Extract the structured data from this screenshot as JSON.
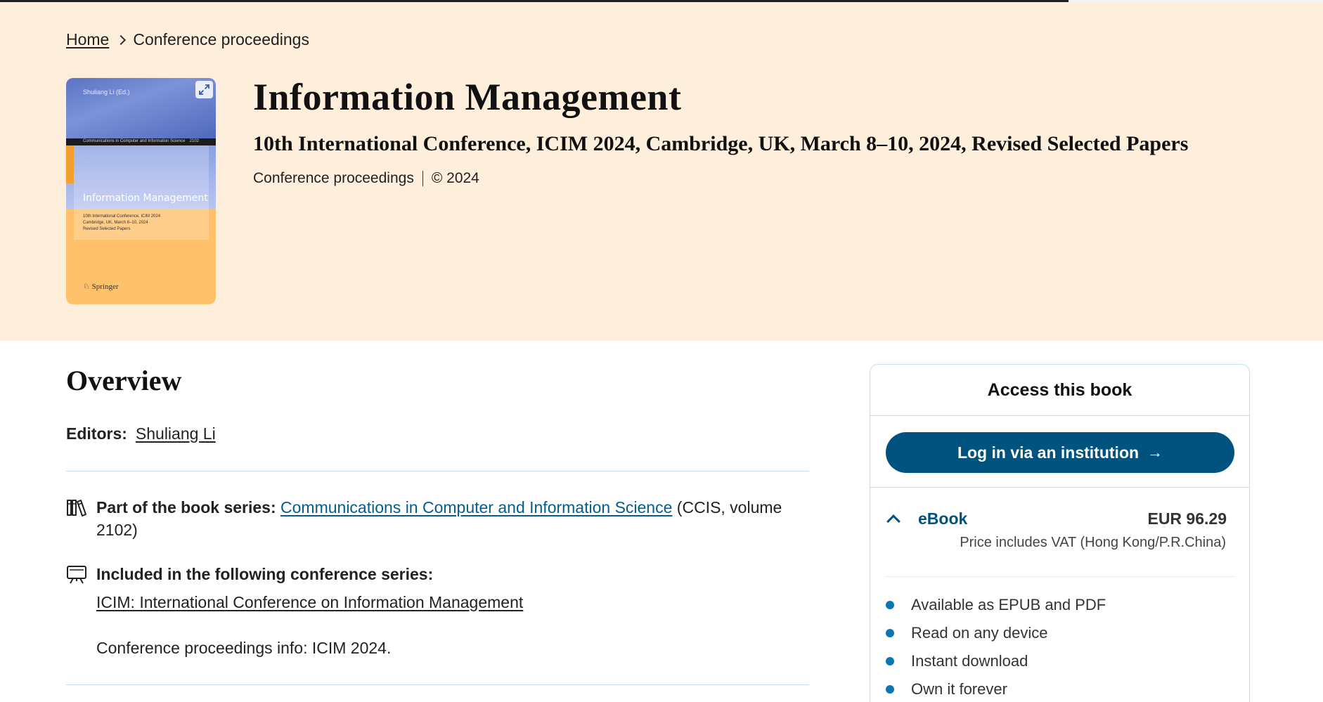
{
  "breadcrumb": {
    "home": "Home",
    "current": "Conference proceedings"
  },
  "cover": {
    "editor": "Shuliang Li (Ed.)",
    "series": "Communications in Computer and Information Science",
    "volume": "2102",
    "title": "Information Management",
    "subtitle_lines": [
      "10th International Conference, ICIM 2024",
      "Cambridge, UK, March 8–10, 2024",
      "Revised Selected Papers"
    ],
    "publisher": "Springer"
  },
  "book": {
    "title": "Information Management",
    "subtitle": "10th International Conference, ICIM 2024, Cambridge, UK, March 8–10, 2024, Revised Selected Papers",
    "type": "Conference proceedings",
    "copyright": "© 2024"
  },
  "overview": {
    "heading": "Overview",
    "editors_label": "Editors:",
    "editor_name": "Shuliang Li",
    "series_label": "Part of the book series:",
    "series_link": "Communications in Computer and Information Science",
    "series_suffix": "(CCIS, volume 2102)",
    "conference_label": "Included in the following conference series:",
    "conference_link": "ICIM: International Conference on Information Management",
    "conference_info": "Conference proceedings info: ICIM 2024."
  },
  "access": {
    "title": "Access this book",
    "login_label": "Log in via an institution",
    "ebook_label": "eBook",
    "ebook_price": "EUR 96.29",
    "vat_note": "Price includes VAT (Hong Kong/P.R.China)",
    "features": [
      "Available as EPUB and PDF",
      "Read on any device",
      "Instant download",
      "Own it forever"
    ]
  },
  "colors": {
    "hero_bg": "#feeedc",
    "link": "#025e8d",
    "button": "#01537f",
    "bullet": "#0c76b5"
  },
  "icons": [
    "chevron-right-icon",
    "expand-icon",
    "books-icon",
    "presentation-icon",
    "arrow-right-icon",
    "chevron-up-icon",
    "bullet-icon"
  ]
}
